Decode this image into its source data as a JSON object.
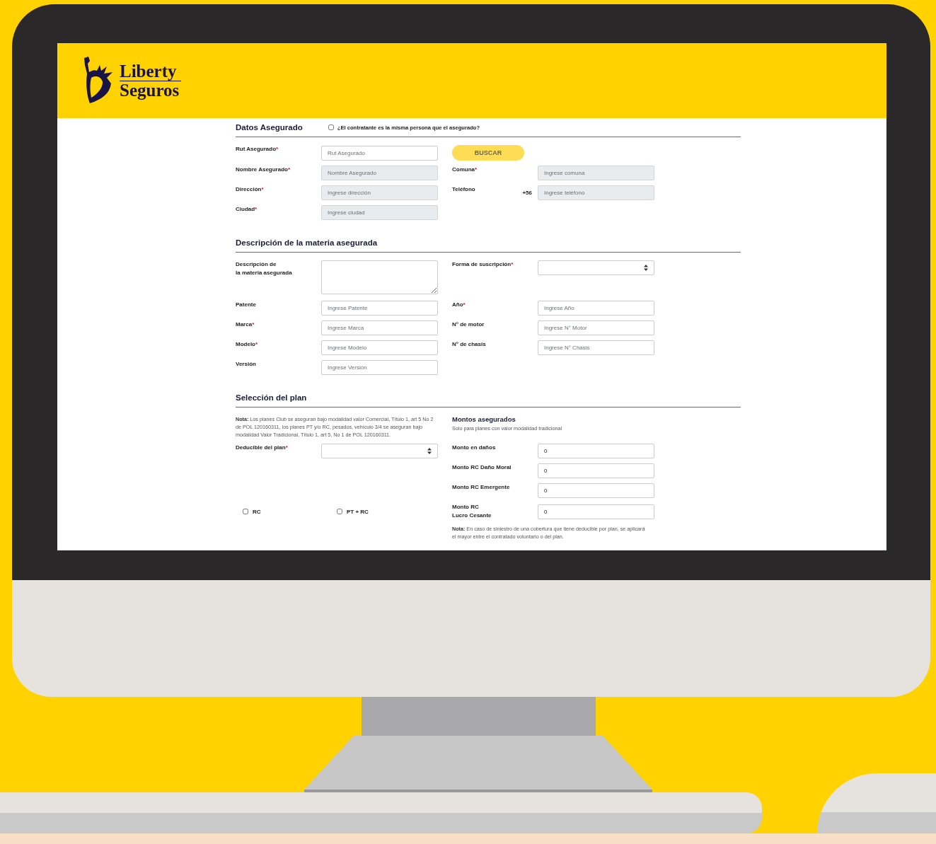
{
  "header": {
    "logo_line_1": "Liberty",
    "logo_line_2": "Seguros"
  },
  "sections": [
    {
      "title": "Datos Asegurado",
      "option": {
        "label": "¿El contratante es la misma persona que el asegurado?",
        "checked": false
      },
      "rows": [
        {
          "left": {
            "kind": "input",
            "label": "Rut Asegurado",
            "required_mark": "*",
            "placeholder": "Rut Asegurado",
            "disabled": false
          },
          "right": {
            "kind": "button",
            "label": "BUSCAR"
          }
        },
        {
          "left": {
            "kind": "input",
            "label": "Nombre Asegurado",
            "required_mark": "*",
            "placeholder": "Nombre Asegurado",
            "disabled": true
          },
          "right": {
            "kind": "input",
            "label": "Comuna",
            "required_mark": "*",
            "placeholder": "Ingrese comuna",
            "disabled": true
          }
        },
        {
          "left": {
            "kind": "input",
            "label": "Dirección",
            "required_mark": "*",
            "placeholder": "Ingrese dirección",
            "disabled": true
          },
          "right": {
            "kind": "input",
            "label": "Teléfono",
            "prefix": "+56",
            "placeholder": "Ingrese teléfono",
            "disabled": true
          }
        },
        {
          "left": {
            "kind": "input",
            "label": "Ciudad",
            "required_mark": "*",
            "placeholder": "Ingrese ciudad",
            "disabled": true
          }
        }
      ]
    },
    {
      "title": "Descripción de la materia asegurada",
      "rows": [
        {
          "left": {
            "kind": "textarea",
            "label": "Descripción de\nla materia asegurada"
          },
          "right": {
            "kind": "select",
            "label": "Forma de suscripción",
            "required_mark": "*"
          }
        },
        {
          "left": {
            "kind": "input",
            "label": "Patente",
            "placeholder": "Ingrese Patente",
            "disabled": false
          },
          "right": {
            "kind": "input",
            "label": "Año",
            "required_mark": "*",
            "placeholder": "Ingrese Año",
            "disabled": false
          }
        },
        {
          "left": {
            "kind": "input",
            "label": "Marca",
            "required_mark": "*",
            "placeholder": "Ingrese Marca",
            "disabled": false
          },
          "right": {
            "kind": "input",
            "label": "N° de motor",
            "placeholder": "Ingrese N° Motor",
            "disabled": false
          }
        },
        {
          "left": {
            "kind": "input",
            "label": "Modelo",
            "required_mark": "*",
            "placeholder": "Ingrese Modelo",
            "disabled": false
          },
          "right": {
            "kind": "input",
            "label": "N° de chasis",
            "placeholder": "Ingrese N° Chasis",
            "disabled": false
          }
        },
        {
          "left": {
            "kind": "input",
            "label": "Versión",
            "placeholder": "Ingrese Versión",
            "disabled": false
          }
        }
      ]
    },
    {
      "title": "Selección del plan",
      "rows": [
        {
          "left": {
            "kind": "note",
            "text": "**Nota:** Los planes Club se aseguran bajo modalidad valor Comercial, Título 1, art 5 No 2 de POL 120160311, los planes PT y/o RC, pesados, vehículo 3/4 se aseguran bajo modalidad Valor Tradicional, Título 1, art 5, No 1 de POL 120160311."
          },
          "right": {
            "kind": "heading",
            "title": "Montos asegurados",
            "subtitle": "Solo para planes con valor modalidad tradicional"
          }
        },
        {
          "left": {
            "kind": "select",
            "label": "Deducible del plan",
            "required_mark": "*"
          },
          "right": {
            "kind": "input",
            "label": "Monto en daños",
            "value": "0",
            "disabled": false
          }
        },
        {
          "right": {
            "kind": "input",
            "label": "Monto RC Daño Moral",
            "value": "0",
            "disabled": false
          }
        },
        {
          "right": {
            "kind": "input",
            "label": "Monto RC Emergente",
            "value": "0",
            "disabled": false
          }
        },
        {
          "left": {
            "kind": "checks",
            "items": [
              {
                "label": "RC",
                "checked": false
              },
              {
                "label": "PT + RC",
                "checked": false
              }
            ]
          },
          "right": {
            "kind": "input",
            "label": "Monto RC\nLucro Cesante",
            "value": "0",
            "disabled": false
          }
        },
        {
          "right": {
            "kind": "note",
            "text": "**Nota:** En caso de siniestro de una cobertura que tiene deducible por plan, se aplicará el mayor entre el contratado voluntario o del plan."
          }
        }
      ]
    }
  ]
}
